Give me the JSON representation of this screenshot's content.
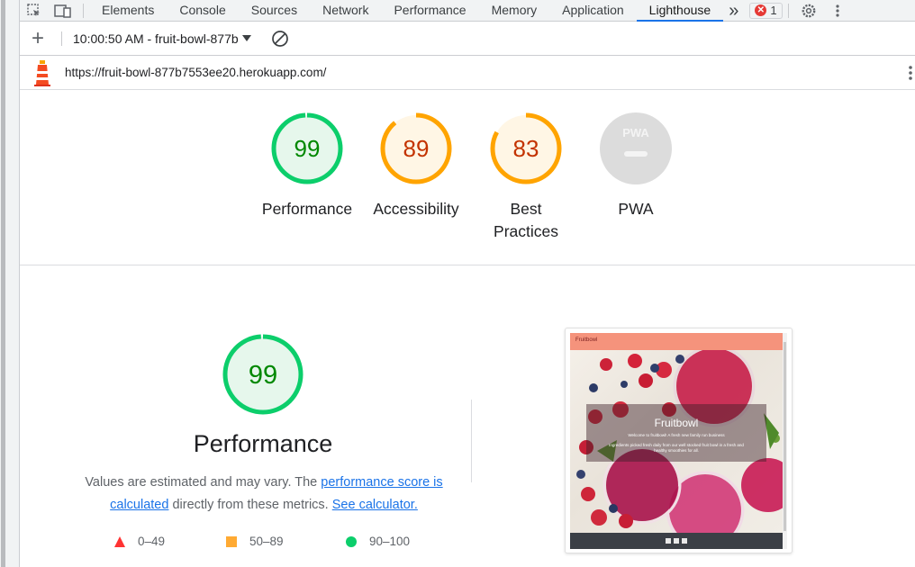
{
  "tabs": {
    "items": [
      {
        "label": "Elements"
      },
      {
        "label": "Console"
      },
      {
        "label": "Sources"
      },
      {
        "label": "Network"
      },
      {
        "label": "Performance"
      },
      {
        "label": "Memory"
      },
      {
        "label": "Application"
      },
      {
        "label": "Lighthouse"
      }
    ],
    "overflow": "»",
    "error_count": "1"
  },
  "toolbar": {
    "add": "+",
    "report_select": "10:00:50 AM - fruit-bowl-877b"
  },
  "url": "https://fruit-bowl-877b7553ee20.herokuapp.com/",
  "gauges": [
    {
      "score": "99",
      "value": 99,
      "label": "Performance",
      "color": "#0cce6b",
      "fill": "#e6f7ec",
      "text_color": "#008800"
    },
    {
      "score": "89",
      "value": 89,
      "label": "Accessibility",
      "color": "#ffa400",
      "fill": "#fff6e5",
      "text_color": "#c33300"
    },
    {
      "score": "83",
      "value": 83,
      "label": "Best Practices",
      "color": "#ffa400",
      "fill": "#fff6e5",
      "text_color": "#c33300"
    },
    {
      "label": "PWA",
      "badge": "PWA"
    }
  ],
  "performance": {
    "score": "99",
    "value": 99,
    "title": "Performance",
    "desc_pre": "Values are estimated and may vary. The ",
    "desc_link1": "performance score is calculated",
    "desc_mid": " directly from these metrics. ",
    "desc_link2": "See calculator."
  },
  "legend": [
    {
      "range": "0–49",
      "color": "#ff3333"
    },
    {
      "range": "50–89",
      "color": "#ffaa33"
    },
    {
      "range": "90–100",
      "color": "#0cce6b"
    }
  ],
  "screenshot": {
    "site_name": "Fruitbowl",
    "hero_title": "Fruitbowl",
    "hero_sub1": "Welcome to fruitbowl! A fresh new family run business",
    "hero_sub2": "Ingredients picked fresh daily from our well stocked fruit bowl in a fresh and healthy smoothies for all."
  }
}
